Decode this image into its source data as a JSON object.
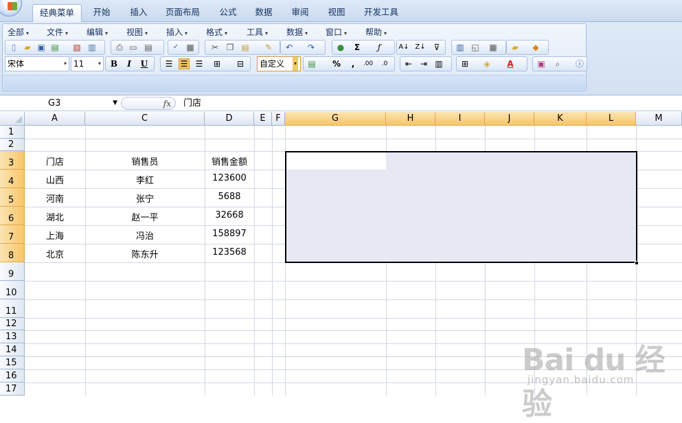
{
  "tabs": [
    "经典菜单",
    "开始",
    "插入",
    "页面布局",
    "公式",
    "数据",
    "审阅",
    "视图",
    "开发工具"
  ],
  "active_tab": "经典菜单",
  "menus": [
    "全部",
    "文件",
    "编辑",
    "视图",
    "插入",
    "格式",
    "工具",
    "数据",
    "窗口",
    "帮助"
  ],
  "font_name": "宋体",
  "font_size": "11",
  "number_format": "自定义",
  "format_buttons": {
    "bold": "B",
    "italic": "I",
    "underline": "U"
  },
  "name_box": "G3",
  "fx_label": "fx",
  "formula_value": "门店",
  "columns": [
    "A",
    "C",
    "D",
    "E",
    "F",
    "G",
    "H",
    "I",
    "J",
    "K",
    "L",
    "M"
  ],
  "rows": [
    "1",
    "2",
    "3",
    "4",
    "5",
    "6",
    "7",
    "8",
    "9",
    "10",
    "11",
    "12",
    "13",
    "14",
    "15",
    "16",
    "17"
  ],
  "table": {
    "headers": [
      "门店",
      "销售员",
      "销售金额"
    ],
    "rows": [
      [
        "山西",
        "李红",
        "123600"
      ],
      [
        "河南",
        "张宁",
        "5688"
      ],
      [
        "湖北",
        "赵一平",
        "32668"
      ],
      [
        "上海",
        "冯治",
        "158897"
      ],
      [
        "北京",
        "陈东升",
        "123568"
      ]
    ]
  },
  "selection": "G3:L8",
  "colors": {
    "selected_header": "#f7c668",
    "selection_fill": "#e6e9f4",
    "gridline": "#d0d7e5"
  },
  "watermark": {
    "logo": "Bai du 经验",
    "url": "jingyan.baidu.com"
  }
}
